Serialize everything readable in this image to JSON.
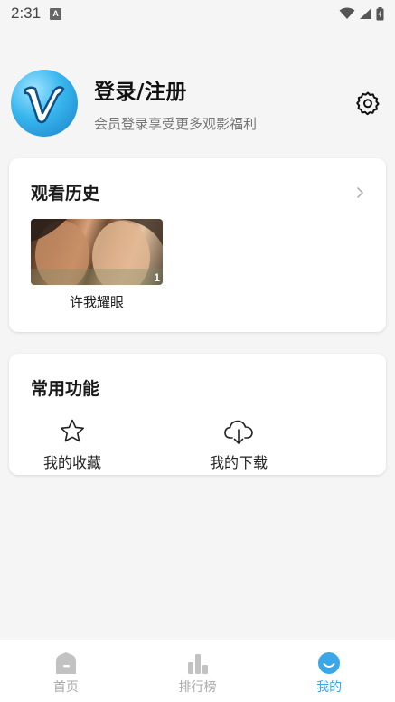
{
  "status_bar": {
    "time": "2:31",
    "app_icon_letter": "A"
  },
  "profile": {
    "title": "登录/注册",
    "subtitle": "会员登录享受更多观影福利",
    "avatar_letter": "V"
  },
  "history": {
    "title": "观看历史",
    "items": [
      {
        "title": "许我耀眼",
        "count": "1"
      }
    ]
  },
  "tools": {
    "title": "常用功能",
    "items": [
      {
        "label": "我的收藏",
        "icon": "star-icon"
      },
      {
        "label": "我的下载",
        "icon": "cloud-download-icon"
      }
    ]
  },
  "nav": {
    "items": [
      {
        "label": "首页",
        "icon": "home-icon",
        "active": false
      },
      {
        "label": "排行榜",
        "icon": "bar-chart-icon",
        "active": false
      },
      {
        "label": "我的",
        "icon": "smile-icon",
        "active": true
      }
    ]
  },
  "colors": {
    "accent": "#3aa7e8",
    "inactive": "#c2c2c2",
    "background": "#f5f5f5"
  }
}
